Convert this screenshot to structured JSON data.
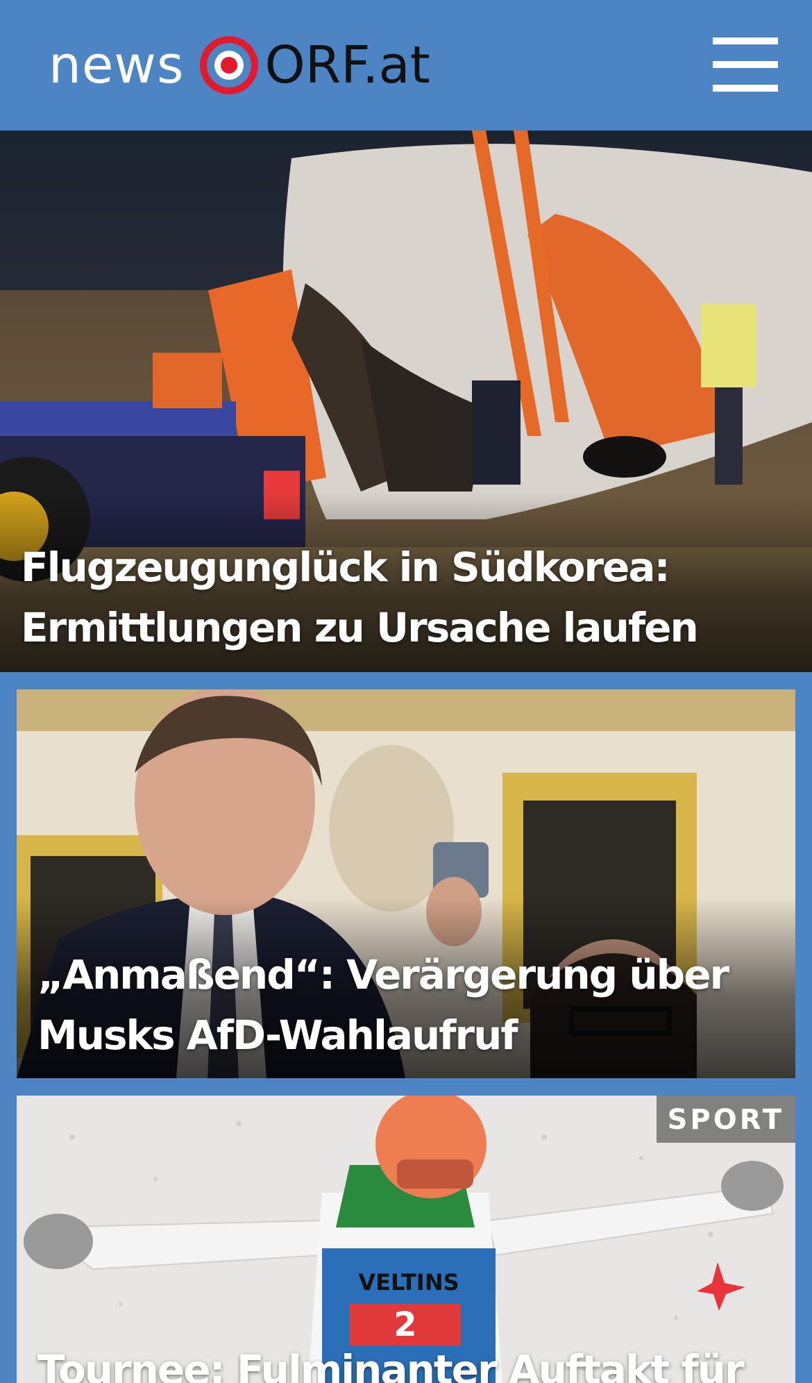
{
  "header": {
    "logo_news": "news",
    "logo_orf": "ORF.at",
    "brand_red": "#e3192c",
    "background": "#4d84c4",
    "menu_icon": "hamburger-menu-icon"
  },
  "stories": [
    {
      "headline": "Flugzeugunglück in Südkorea: Ermittlungen zu Ursache laufen"
    },
    {
      "headline": "„Anmaßend“: Verärgerung über Musks AfD-Wahlaufruf"
    },
    {
      "headline": "Tournee: Fulminanter Auftakt für",
      "badge": "SPORT"
    }
  ]
}
